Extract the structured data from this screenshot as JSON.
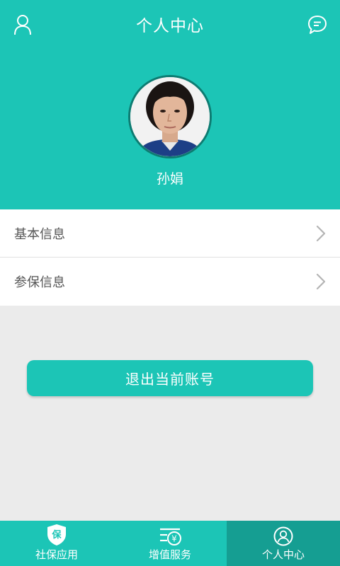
{
  "header": {
    "title": "个人中心",
    "user_icon": "user-icon",
    "message_icon": "message-icon"
  },
  "profile": {
    "name": "孙娟"
  },
  "menu": {
    "items": [
      {
        "label": "基本信息",
        "icon": "chevron-right-icon"
      },
      {
        "label": "参保信息",
        "icon": "chevron-right-icon"
      }
    ]
  },
  "logout_label": "退出当前账号",
  "tabbar": {
    "tabs": [
      {
        "label": "社保应用",
        "icon": "shield-icon",
        "icon_text": "保",
        "active": false
      },
      {
        "label": "增值服务",
        "icon": "yuan-service-icon",
        "icon_text": "¥",
        "active": false
      },
      {
        "label": "个人中心",
        "icon": "user-circle-icon",
        "active": true
      }
    ]
  },
  "colors": {
    "primary": "#1cc5b6",
    "active_tab": "#159e92",
    "background": "#ebebeb"
  }
}
